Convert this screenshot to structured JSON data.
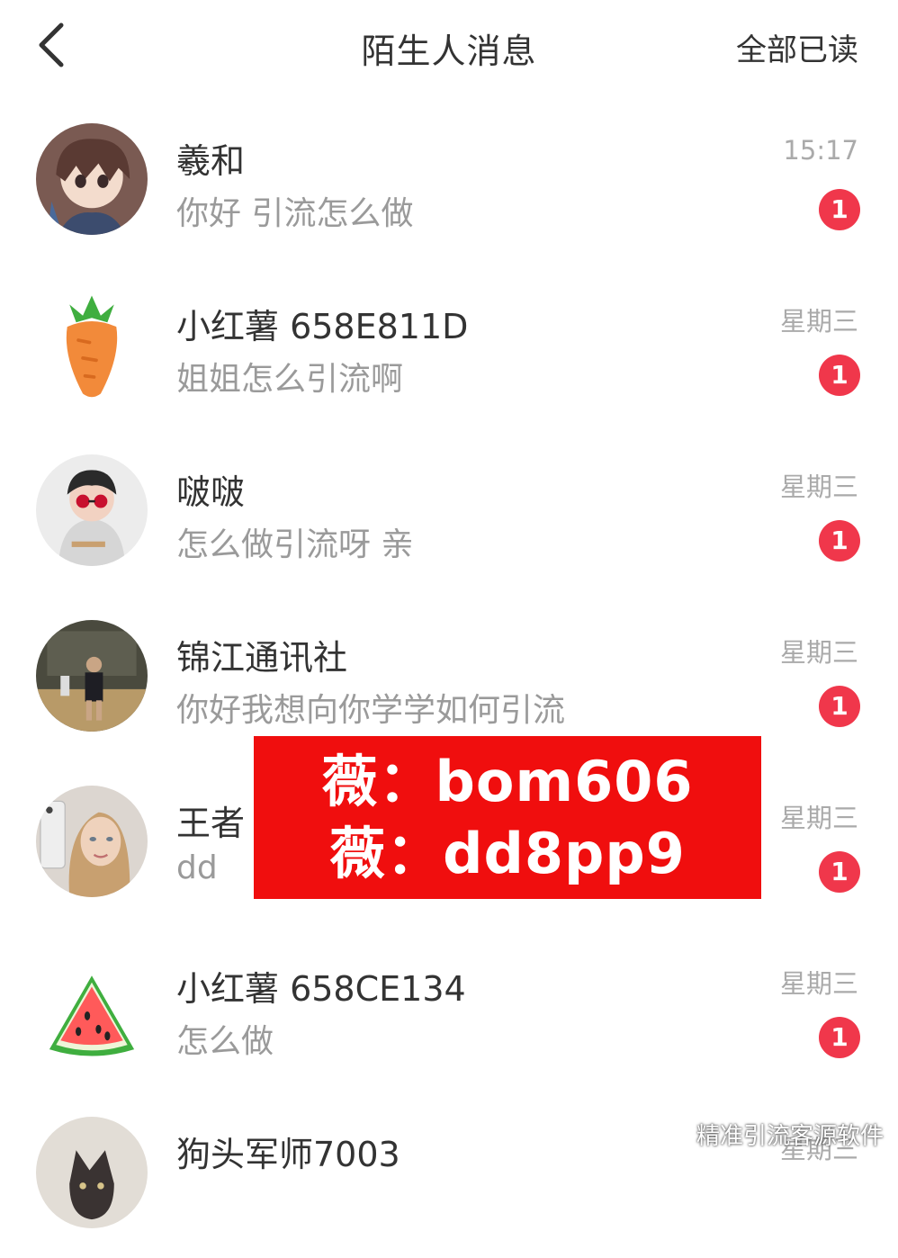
{
  "header": {
    "title": "陌生人消息",
    "mark_all_read": "全部已读"
  },
  "messages": [
    {
      "name": "羲和",
      "preview": "你好 引流怎么做",
      "time": "15:17",
      "unread": "1",
      "avatar": "anime-girl-avatar"
    },
    {
      "name": "小红薯 658E811D",
      "preview": "姐姐怎么引流啊",
      "time": "星期三",
      "unread": "1",
      "avatar": "carrot-avatar"
    },
    {
      "name": "啵啵",
      "preview": "怎么做引流呀 亲",
      "time": "星期三",
      "unread": "1",
      "avatar": "child-photo-avatar"
    },
    {
      "name": "锦江通讯社",
      "preview": "你好我想向你学学如何引流",
      "time": "星期三",
      "unread": "1",
      "avatar": "basketball-photo-avatar"
    },
    {
      "name": "王者",
      "preview": "dd",
      "time": "星期三",
      "unread": "1",
      "avatar": "woman-selfie-avatar"
    },
    {
      "name": "小红薯 658CE134",
      "preview": "怎么做",
      "time": "星期三",
      "unread": "1",
      "avatar": "watermelon-avatar"
    },
    {
      "name": "狗头军师7003",
      "preview": "",
      "time": "星期三",
      "unread": "",
      "avatar": "cat-photo-avatar"
    }
  ],
  "promo": {
    "line1": "薇：bom606",
    "line2": "薇：dd8pp9",
    "background": "#f00e0e"
  },
  "watermark": {
    "text": "精准引流客源软件",
    "icon": "wechat-icon"
  },
  "colors": {
    "badge": "#f0374b",
    "secondary_text": "#9a9a9a"
  }
}
